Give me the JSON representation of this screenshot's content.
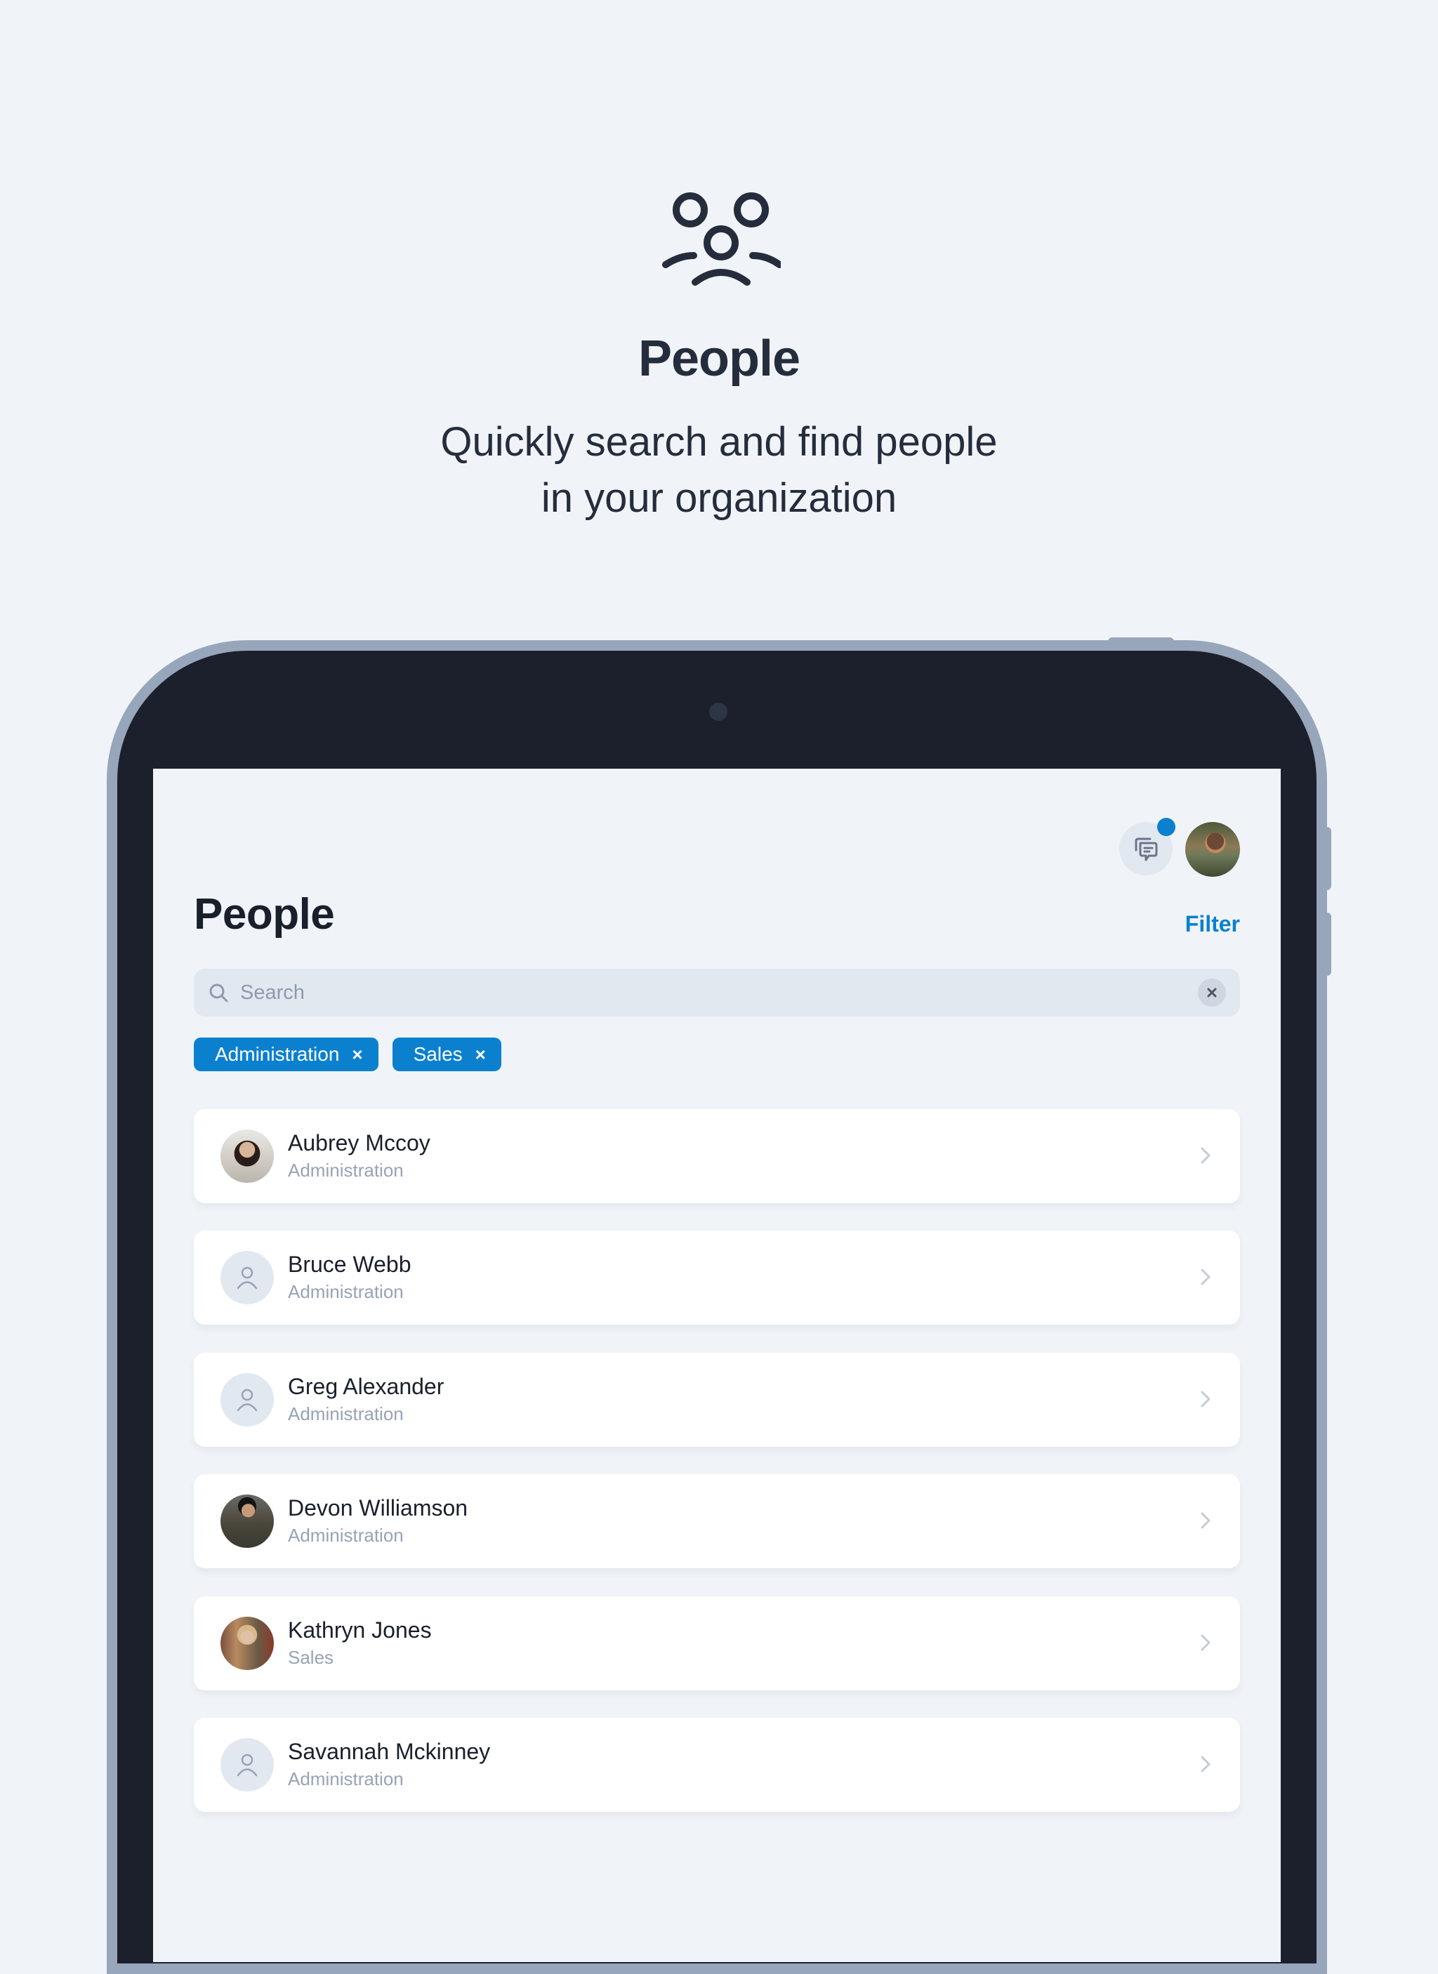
{
  "hero": {
    "icon": "people-group-icon",
    "title": "People",
    "subtitle_line1": "Quickly search and find people",
    "subtitle_line2": "in your organization"
  },
  "app": {
    "header": {
      "chat_icon": "chat-bubbles-icon",
      "has_notification": true,
      "user_avatar": "user-avatar-photo"
    },
    "page_title": "People",
    "filter_label": "Filter",
    "search": {
      "placeholder": "Search",
      "value": ""
    },
    "active_filters": [
      {
        "label": "Administration",
        "remove": "×"
      },
      {
        "label": "Sales",
        "remove": "×"
      }
    ],
    "people": [
      {
        "name": "Aubrey Mccoy",
        "department": "Administration",
        "avatar": "photo"
      },
      {
        "name": "Bruce Webb",
        "department": "Administration",
        "avatar": "placeholder"
      },
      {
        "name": "Greg Alexander",
        "department": "Administration",
        "avatar": "placeholder"
      },
      {
        "name": "Devon Williamson",
        "department": "Administration",
        "avatar": "photo"
      },
      {
        "name": "Kathryn Jones",
        "department": "Sales",
        "avatar": "photo"
      },
      {
        "name": "Savannah Mckinney",
        "department": "Administration",
        "avatar": "placeholder"
      }
    ]
  },
  "colors": {
    "accent": "#0b80cf",
    "background": "#f0f4f8",
    "bezel": "#1c202c",
    "frame": "#97a6ba",
    "text_primary": "#1a1f2c",
    "text_secondary": "#97a3b6"
  }
}
